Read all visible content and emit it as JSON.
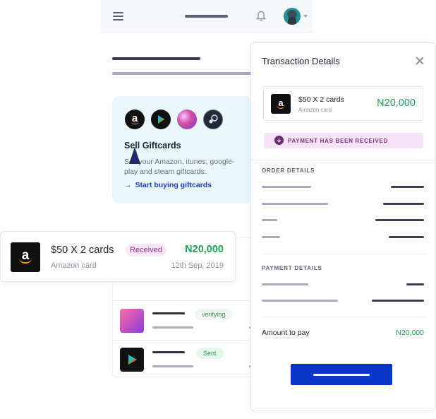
{
  "topbar": {
    "menu_icon": "hamburger-icon",
    "bell_icon": "bell-icon"
  },
  "promo": {
    "brands": [
      "amazon",
      "google-play",
      "itunes",
      "steam"
    ],
    "title": "Sell Giftcards",
    "description": "Sell your Amazon, itunes, google-play and steam giftcards.",
    "link_arrow": "→",
    "link_label": "Start buying giftcards"
  },
  "list": {
    "rows": [
      {
        "status": "verifying"
      },
      {
        "status": "Sent"
      }
    ]
  },
  "transaction": {
    "logo_letter": "a",
    "title": "$50 X 2 cards",
    "subtitle": "Amazon card",
    "status": "Received",
    "amount": "N20,000",
    "date": "12th Sep, 2019"
  },
  "details": {
    "title": "Transaction Details",
    "card_title": "$50 X 2 cards",
    "card_subtitle": "Amazon card",
    "card_amount": "N20,000",
    "notice": "PAYMENT HAS BEEN RECEIVED",
    "order_label": "ORDER DETAILS",
    "payment_label": "PAYMENT DETAILS",
    "amount_label": "Amount to pay",
    "amount_value": "N20,000"
  },
  "colors": {
    "accent": "#0a34c8",
    "success": "#1ea354",
    "received_bg": "#f7e6f6"
  }
}
